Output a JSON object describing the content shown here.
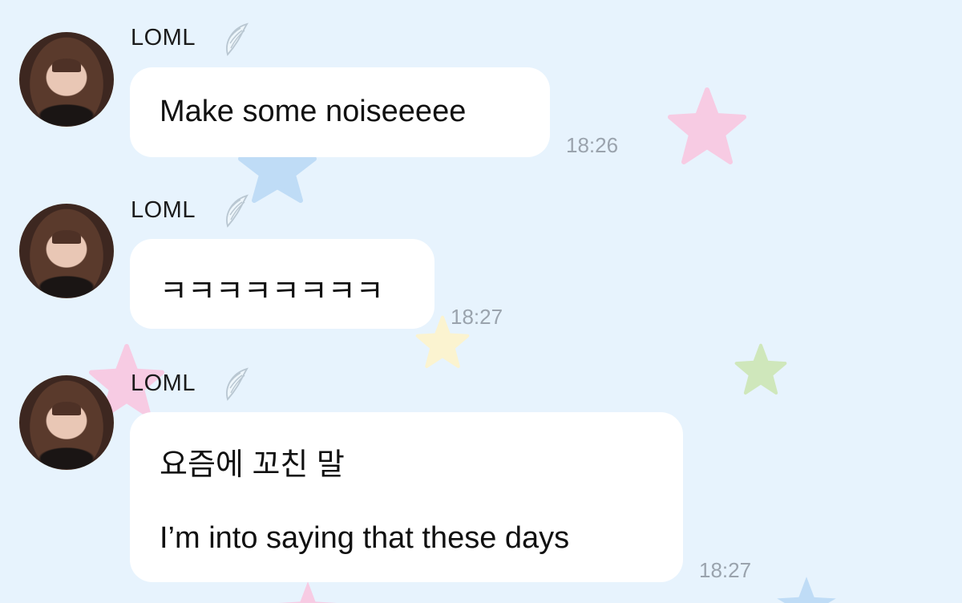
{
  "messages": [
    {
      "sender": "LOML",
      "lines": [
        "Make some noiseeeee"
      ],
      "time": "18:26"
    },
    {
      "sender": "LOML",
      "lines": [
        "ㅋㅋㅋㅋㅋㅋㅋㅋ"
      ],
      "time": "18:27"
    },
    {
      "sender": "LOML",
      "lines": [
        "요즘에 꼬친 말",
        "I’m into saying that these days"
      ],
      "time": "18:27"
    }
  ],
  "icons": {
    "avatar": "profile-photo",
    "badge": "angel-wing-icon",
    "decor": "star-icon"
  },
  "colors": {
    "background": "#e7f3fd",
    "bubble": "#ffffff",
    "timestamp": "#9aa3ad",
    "star_pink": "#f7cbe3",
    "star_blue": "#bfdcf6",
    "star_yellow": "#fbf3d0",
    "star_green": "#cfe7bb"
  }
}
